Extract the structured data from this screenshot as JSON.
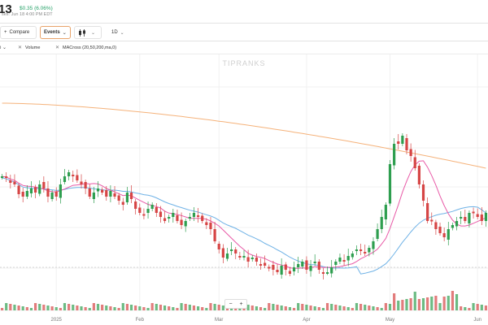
{
  "header": {
    "price": "13",
    "change": "$0.35 (6.06%)",
    "close_time": "ses: Jun 18 4:00 PM EDT"
  },
  "toolbar": {
    "compare_label": "Compare",
    "events_label": "Events",
    "interval_label": "1D"
  },
  "indicators": [
    {
      "label": "Volume"
    },
    {
      "label": "MACross (20,50,200,ma,0)"
    }
  ],
  "colors": {
    "up": "#2e9e4f",
    "down": "#d64545",
    "ma20": "#e85aa7",
    "ma50": "#6fb2e6",
    "ma200": "#f5b27a",
    "accent": "#e8a36a"
  },
  "chart_data": {
    "type": "candlestick",
    "watermark": "TIPRANKS",
    "x_tick_labels": [
      {
        "label": "2025",
        "i": 13
      },
      {
        "label": "Feb",
        "i": 33
      },
      {
        "label": "Mar",
        "i": 52
      },
      {
        "label": "Apr",
        "i": 73
      },
      {
        "label": "May",
        "i": 93
      },
      {
        "label": "Jun",
        "i": 114
      }
    ]
  },
  "zoom": {
    "minus": "−",
    "plus": "+"
  }
}
